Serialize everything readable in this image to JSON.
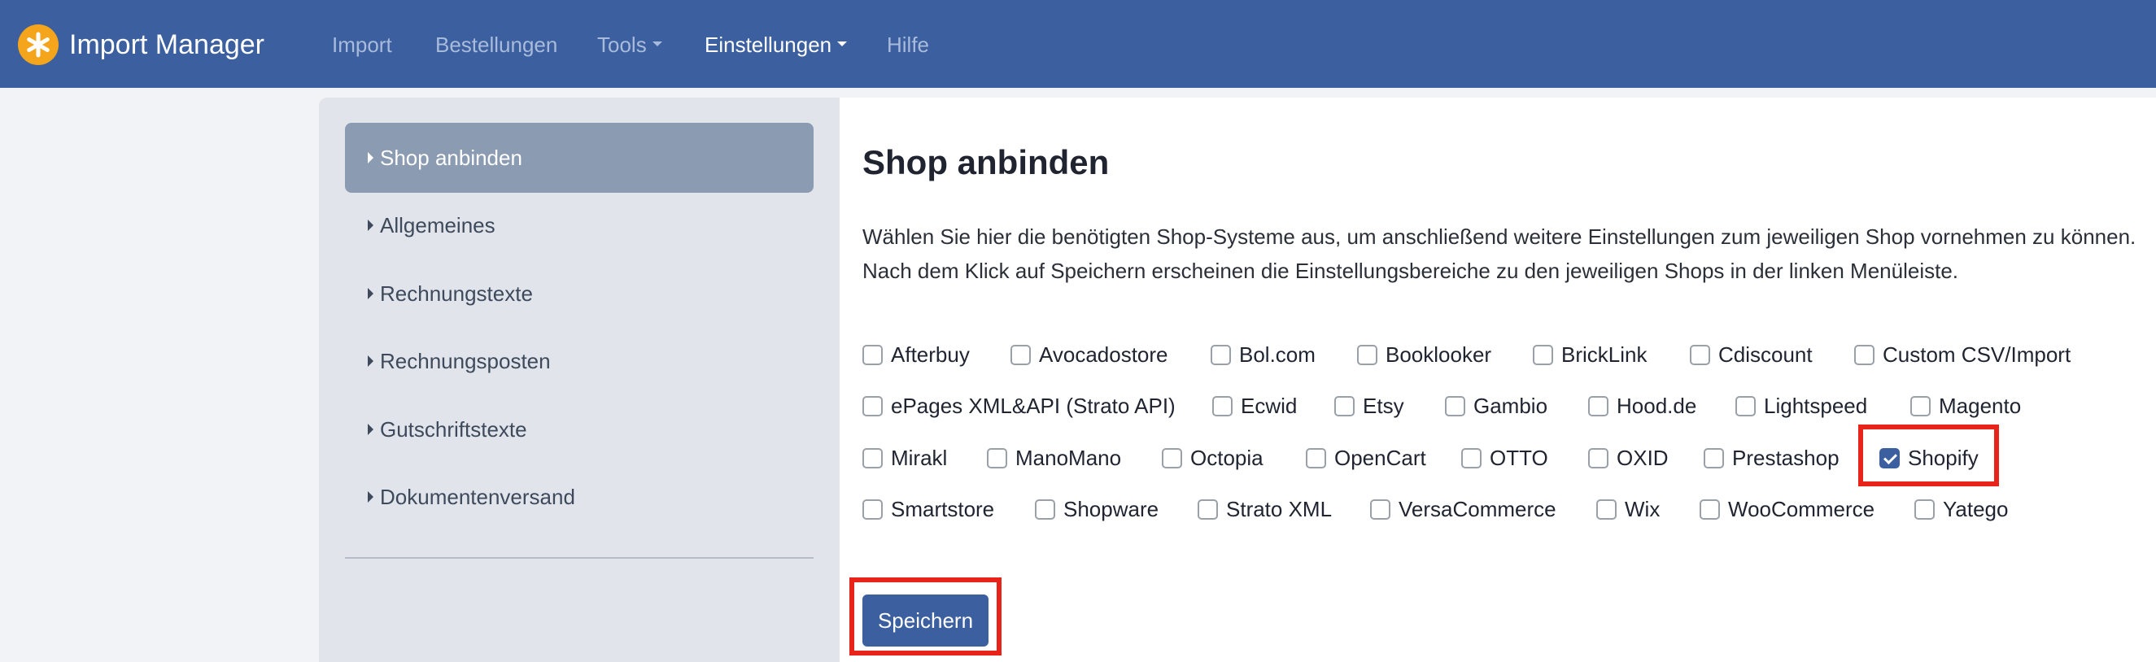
{
  "app": {
    "title": "Import Manager"
  },
  "nav": {
    "items": [
      {
        "label": "Import",
        "dropdown": false,
        "active": false
      },
      {
        "label": "Bestellungen",
        "dropdown": false,
        "active": false
      },
      {
        "label": "Tools",
        "dropdown": true,
        "active": false
      },
      {
        "label": "Einstellungen",
        "dropdown": true,
        "active": true
      },
      {
        "label": "Hilfe",
        "dropdown": false,
        "active": false
      }
    ]
  },
  "sidebar": {
    "items": [
      {
        "label": "Shop anbinden",
        "active": true
      },
      {
        "label": "Allgemeines",
        "active": false
      },
      {
        "label": "Rechnungstexte",
        "active": false
      },
      {
        "label": "Rechnungsposten",
        "active": false
      },
      {
        "label": "Gutschriftstexte",
        "active": false
      },
      {
        "label": "Dokumentenversand",
        "active": false
      }
    ]
  },
  "main": {
    "title": "Shop anbinden",
    "description": [
      "Wählen Sie hier die benötigten Shop-Systeme aus, um anschließend weitere Einstellungen zum jeweiligen Shop vornehmen zu können.",
      "Nach dem Klick auf Speichern erscheinen die Einstellungsbereiche zu den jeweiligen Shops in der linken Menüleiste."
    ],
    "shops": [
      [
        {
          "label": "Afterbuy",
          "checked": false
        },
        {
          "label": "Avocadostore",
          "checked": false
        },
        {
          "label": "Bol.com",
          "checked": false
        },
        {
          "label": "Booklooker",
          "checked": false
        },
        {
          "label": "BrickLink",
          "checked": false
        },
        {
          "label": "Cdiscount",
          "checked": false
        },
        {
          "label": "Custom CSV/Import",
          "checked": false
        }
      ],
      [
        {
          "label": "ePages XML&API (Strato API)",
          "checked": false
        },
        {
          "label": "Ecwid",
          "checked": false
        },
        {
          "label": "Etsy",
          "checked": false
        },
        {
          "label": "Gambio",
          "checked": false
        },
        {
          "label": "Hood.de",
          "checked": false
        },
        {
          "label": "Lightspeed",
          "checked": false
        },
        {
          "label": "Magento",
          "checked": false
        }
      ],
      [
        {
          "label": "Mirakl",
          "checked": false
        },
        {
          "label": "ManoMano",
          "checked": false
        },
        {
          "label": "Octopia",
          "checked": false
        },
        {
          "label": "OpenCart",
          "checked": false
        },
        {
          "label": "OTTO",
          "checked": false
        },
        {
          "label": "OXID",
          "checked": false
        },
        {
          "label": "Prestashop",
          "checked": false
        },
        {
          "label": "Shopify",
          "checked": true
        }
      ],
      [
        {
          "label": "Smartstore",
          "checked": false
        },
        {
          "label": "Shopware",
          "checked": false
        },
        {
          "label": "Strato XML",
          "checked": false
        },
        {
          "label": "VersaCommerce",
          "checked": false
        },
        {
          "label": "Wix",
          "checked": false
        },
        {
          "label": "WooCommerce",
          "checked": false
        },
        {
          "label": "Yatego",
          "checked": false
        }
      ]
    ],
    "save_label": "Speichern"
  },
  "colors": {
    "navbar": "#3b5f9f",
    "accent": "#3b5f9f",
    "logo": "#f4a51c",
    "highlight": "#e8231a"
  }
}
